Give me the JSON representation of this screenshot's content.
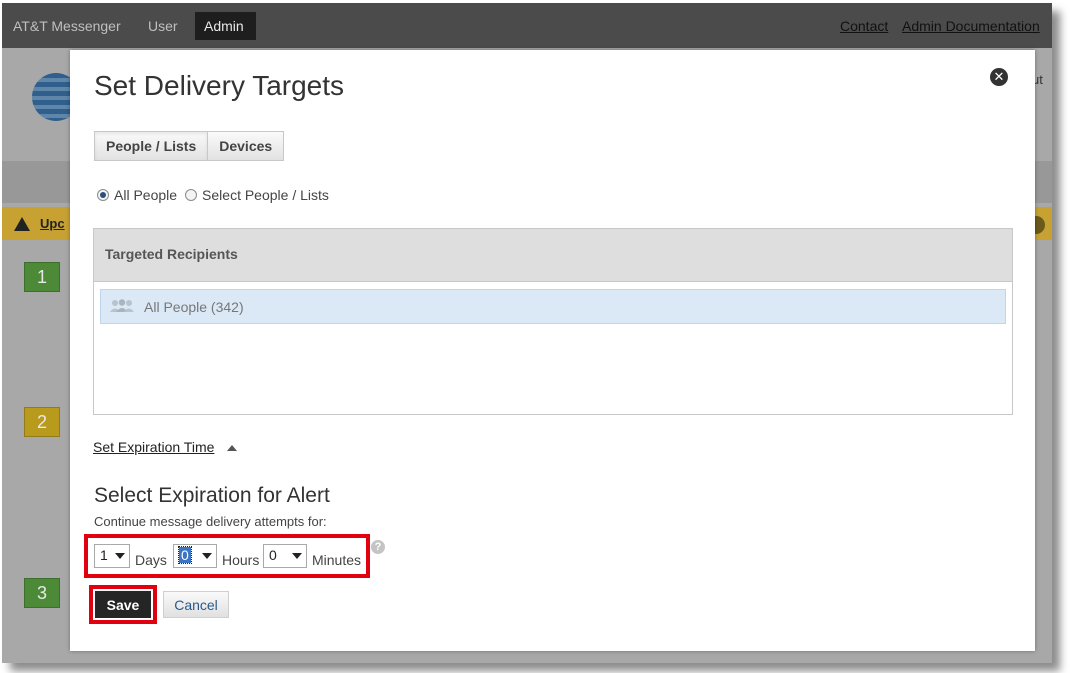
{
  "topbar": {
    "app_name": "AT&T Messenger",
    "nav_user": "User",
    "nav_admin": "Admin",
    "contact": "Contact",
    "admin_docs": "Admin Documentation"
  },
  "background": {
    "logout_fragment": "ut",
    "alert_text": "Upc",
    "steps": [
      "1",
      "2",
      "3"
    ],
    "colors": {
      "step_green": "#4c8a38",
      "step_yellow": "#b89a1d",
      "alert": "#c7a233"
    }
  },
  "modal": {
    "title": "Set Delivery Targets",
    "close_icon": "close-circle-icon",
    "tabs": {
      "people": "People / Lists",
      "devices": "Devices"
    },
    "radios": [
      {
        "label": "All People",
        "checked": true
      },
      {
        "label": "Select People / Lists",
        "checked": false
      }
    ],
    "recipients": {
      "header": "Targeted Recipients",
      "items": [
        {
          "label": "All People (342)",
          "icon": "people-group-icon"
        }
      ]
    },
    "expiration": {
      "toggle_label": "Set Expiration Time",
      "heading": "Select Expiration for Alert",
      "subtext": "Continue message delivery attempts for:",
      "days": {
        "value": "1",
        "unit": "Days"
      },
      "hours": {
        "value": "0",
        "unit": "Hours"
      },
      "minutes": {
        "value": "0",
        "unit": "Minutes"
      },
      "help_icon": "question-icon"
    },
    "buttons": {
      "save": "Save",
      "cancel": "Cancel"
    },
    "highlight_color": "#e00010"
  }
}
